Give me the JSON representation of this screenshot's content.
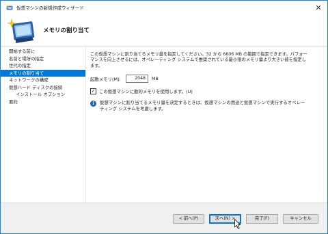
{
  "window": {
    "title": "仮想マシンの新規作成ウィザード"
  },
  "header": {
    "title": "メモリの割り当て"
  },
  "nav": {
    "items": [
      {
        "label": "開始する前に",
        "selected": false,
        "sub": false
      },
      {
        "label": "名前と場所の指定",
        "selected": false,
        "sub": false
      },
      {
        "label": "世代の指定",
        "selected": false,
        "sub": false
      },
      {
        "label": "メモリの割り当て",
        "selected": true,
        "sub": false
      },
      {
        "label": "ネットワークの構成",
        "selected": false,
        "sub": false
      },
      {
        "label": "仮想ハード ディスクの接続",
        "selected": false,
        "sub": false
      },
      {
        "label": "インストール オプション",
        "selected": false,
        "sub": true
      },
      {
        "label": "要約",
        "selected": false,
        "sub": false
      }
    ]
  },
  "main": {
    "description_line1": "この仮想マシンに割り当てるメモリ量を指定してください。32 から 6606 MB の範囲で指定できます。パフォー",
    "description_line2": "マンスを向上させるには、オペレーティング システムで推奨されている最小限のメモリ量より大きい値を指定し",
    "description_line3": "ます。",
    "startup_memory_label": "起動メモリ(M):",
    "startup_memory_value": "2048",
    "startup_memory_unit": "MB",
    "dynamic_memory_label": "この仮想マシンに動的メモリを使用します。(U)",
    "dynamic_memory_checked": true,
    "info_line1": "仮想マシンに割り当てるメモリ量を決定するときは、仮想マシンの用途と仮想マシンで実行するオペレー",
    "info_line2": "ティング システムを考慮します。"
  },
  "footer": {
    "back_label": "< 前へ(P)",
    "next_label": "次へ(N) >",
    "finish_label": "完了(F)",
    "cancel_label": "キャンセル"
  },
  "colors": {
    "accent": "#0078d7",
    "info_icon": "#1c64c8"
  },
  "icons": {
    "app": "hyper-v-wizard-icon",
    "header": "computer-with-sparkle-icon",
    "info": "info-icon",
    "close": "close-icon",
    "cursor": "mouse-pointer-icon"
  }
}
